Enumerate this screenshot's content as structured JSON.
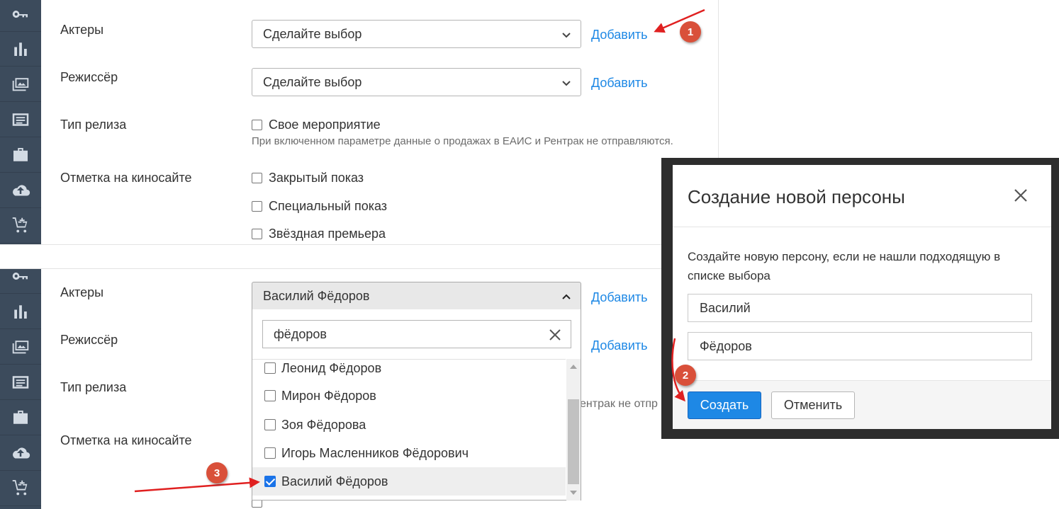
{
  "top_form": {
    "actors_label": "Актеры",
    "actors_select": "Сделайте выбор",
    "director_label": "Режиссёр",
    "director_select": "Сделайте выбор",
    "add_link": "Добавить",
    "release_type_label": "Тип релиза",
    "own_event_label": "Свое мероприятие",
    "own_event_hint": "При включенном параметре данные о продажах в ЕАИС и Рентрак не отправляются.",
    "site_mark_label": "Отметка на киносайте",
    "closed_show_label": "Закрытый показ",
    "special_show_label": "Специальный показ",
    "star_premiere_label": "Звёздная премьера"
  },
  "bottom_form": {
    "actors_label": "Актеры",
    "actors_select": "Василий Фёдоров",
    "director_label": "Режиссёр",
    "add_link": "Добавить",
    "release_type_label": "Тип релиза",
    "hint_fragment": "ентрак не отпр",
    "site_mark_label": "Отметка на киносайте",
    "search_value": "фёдоров",
    "options": [
      {
        "label": "Леонид Фёдоров",
        "checked": false
      },
      {
        "label": "Мирон Фёдоров",
        "checked": false
      },
      {
        "label": "Зоя Фёдорова",
        "checked": false
      },
      {
        "label": "Игорь Масленников Фёдорович",
        "checked": false
      },
      {
        "label": "Василий Фёдоров",
        "checked": true
      }
    ]
  },
  "modal": {
    "title": "Создание новой персоны",
    "text": "Создайте новую персону, если не нашли подходящую в списке выбора",
    "first_name": "Василий",
    "last_name": "Фёдоров",
    "create_button": "Создать",
    "cancel_button": "Отменить"
  },
  "sidebar_icons": [
    "key-icon",
    "bar-chart-icon",
    "images-icon",
    "list-icon",
    "briefcase-icon",
    "cloud-upload-icon",
    "cart-add-icon"
  ],
  "badges": [
    "1",
    "2",
    "3"
  ],
  "colors": {
    "sidebar": "#3c4b5c",
    "link": "#1e88e5",
    "badge": "#d9503a",
    "arrow": "#e02020",
    "primary": "#1e88e5"
  }
}
